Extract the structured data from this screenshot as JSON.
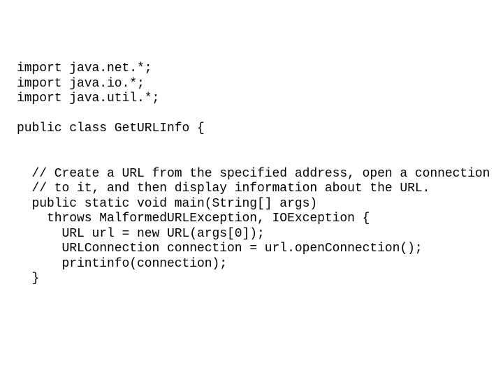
{
  "slide": {
    "background_color": "#ffffff",
    "text_color": "#000000",
    "language": "java",
    "class_name": "GetURLInfo",
    "code_lines": [
      "import java.net.*;",
      "import java.io.*;",
      "import java.util.*;",
      "",
      "public class GetURLInfo {",
      "",
      "",
      "  // Create a URL from the specified address, open a connection",
      "  // to it, and then display information about the URL.",
      "  public static void main(String[] args)",
      "    throws MalformedURLException, IOException {",
      "      URL url = new URL(args[0]);",
      "      URLConnection connection = url.openConnection();",
      "      printinfo(connection);",
      "  }"
    ]
  }
}
